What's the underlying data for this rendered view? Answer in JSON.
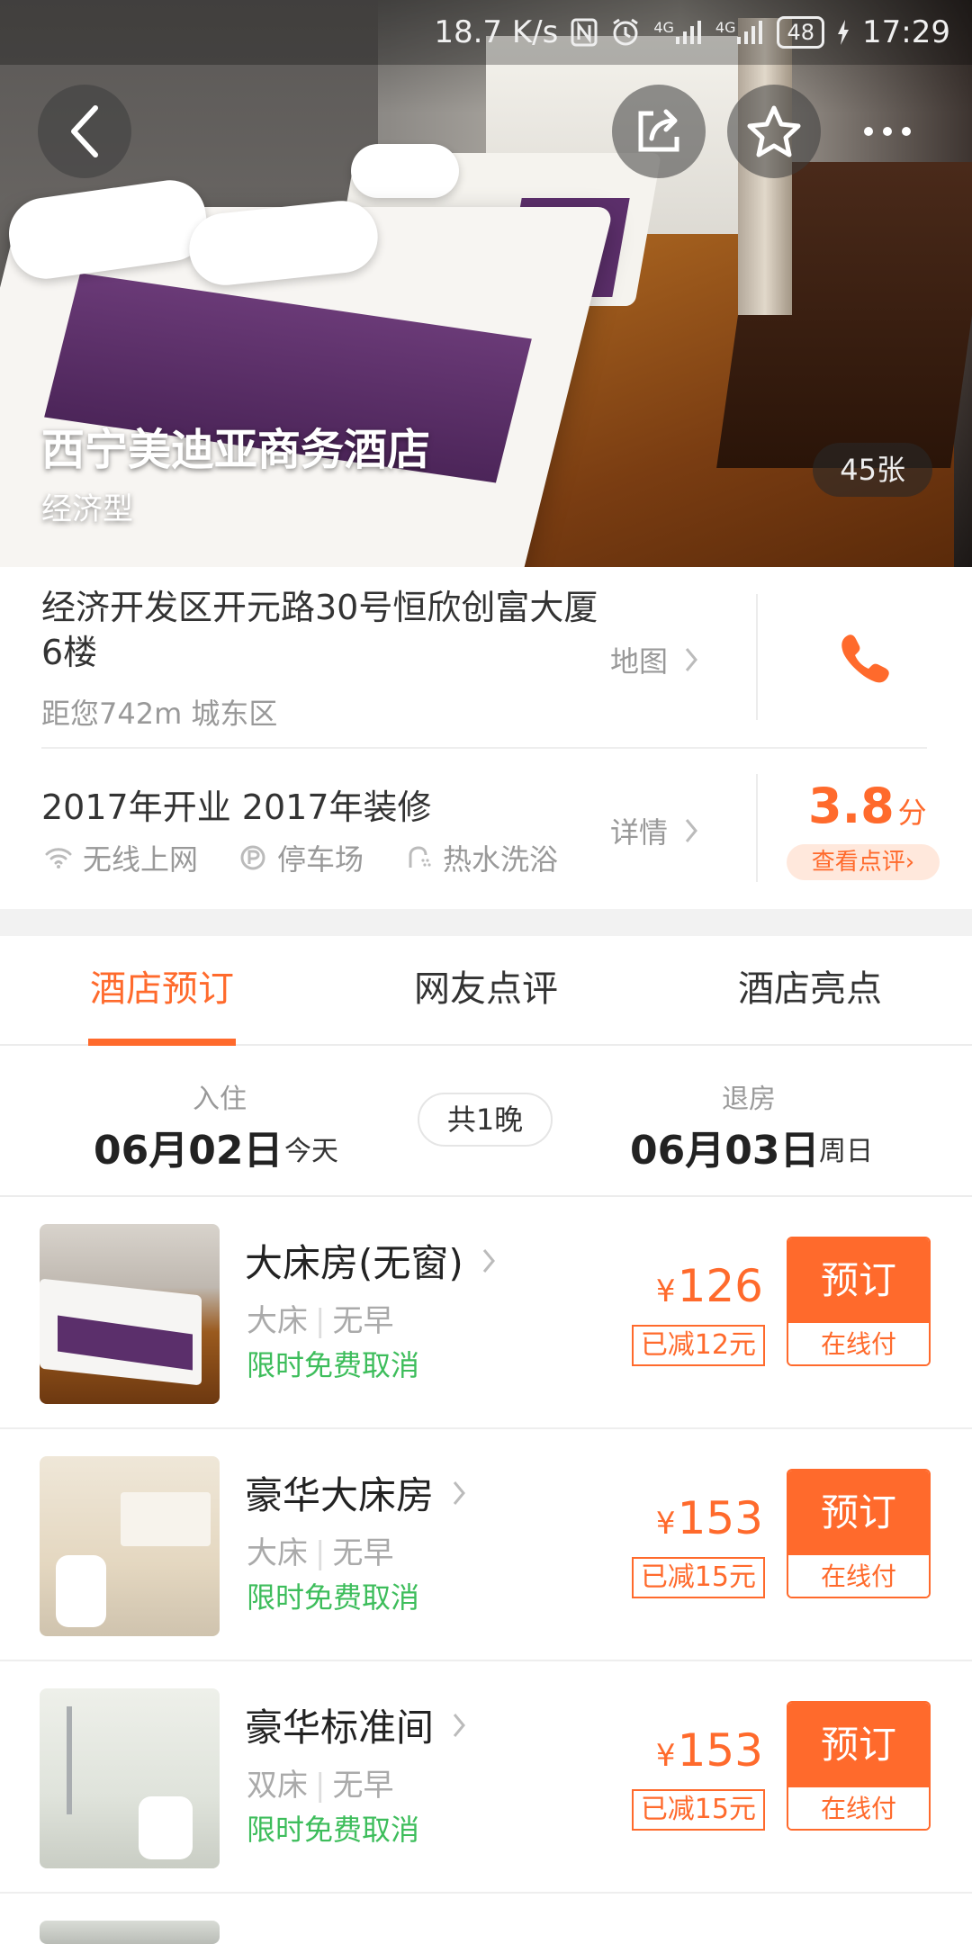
{
  "statusbar": {
    "speed": "18.7 K/s",
    "net1": "4G",
    "net2": "4G",
    "battery": "48",
    "time": "17:29"
  },
  "hero": {
    "title": "西宁美迪亚商务酒店",
    "subtitle": "经济型",
    "photo_count": "45张"
  },
  "info": {
    "address": "经济开发区开元路30号恒欣创富大厦6楼",
    "distance": "距您742m 城东区",
    "map_label": "地图",
    "opened": "2017年开业  2017年装修",
    "detail_label": "详情",
    "amenities": [
      "无线上网",
      "停车场",
      "热水洗浴"
    ],
    "score": "3.8",
    "score_unit": "分",
    "review_link": "查看点评"
  },
  "tabs": [
    "酒店预订",
    "网友点评",
    "酒店亮点"
  ],
  "dates": {
    "checkin_label": "入住",
    "checkin_date": "06月02日",
    "checkin_day": "今天",
    "nights": "共1晚",
    "checkout_label": "退房",
    "checkout_date": "06月03日",
    "checkout_day": "周日"
  },
  "rooms": [
    {
      "name": "大床房(无窗)",
      "bed": "大床",
      "meal": "无早",
      "cancel": "限时免费取消",
      "currency": "¥",
      "price": "126",
      "discount": "已减12元",
      "book": "预订",
      "pay": "在线付"
    },
    {
      "name": "豪华大床房",
      "bed": "大床",
      "meal": "无早",
      "cancel": "限时免费取消",
      "currency": "¥",
      "price": "153",
      "discount": "已减15元",
      "book": "预订",
      "pay": "在线付"
    },
    {
      "name": "豪华标准间",
      "bed": "双床",
      "meal": "无早",
      "cancel": "限时免费取消",
      "currency": "¥",
      "price": "153",
      "discount": "已减15元",
      "book": "预订",
      "pay": "在线付"
    }
  ],
  "colors": {
    "accent": "#ff6a2c",
    "green": "#3dbd5b",
    "muted": "#999999"
  }
}
